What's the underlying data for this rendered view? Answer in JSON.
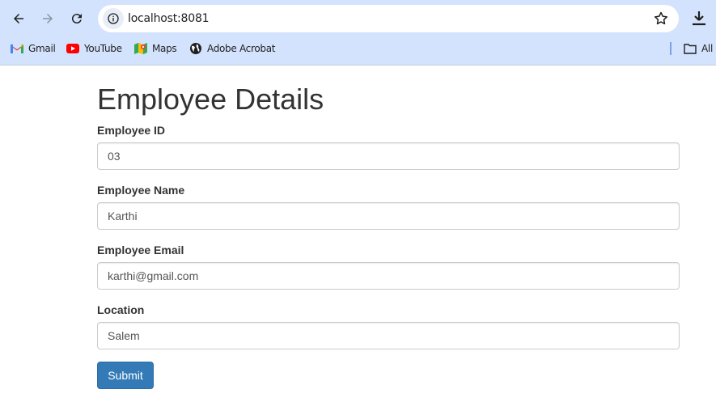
{
  "browser": {
    "url": "localhost:8081",
    "bookmarks": [
      {
        "label": "Gmail",
        "icon": "gmail-icon"
      },
      {
        "label": "YouTube",
        "icon": "youtube-icon"
      },
      {
        "label": "Maps",
        "icon": "maps-icon"
      },
      {
        "label": "Adobe Acrobat",
        "icon": "globe-icon"
      }
    ],
    "all_bookmarks_label": "All",
    "colors": {
      "chrome_bg": "#d3e3fd",
      "accent": "#337ab7"
    }
  },
  "page": {
    "title": "Employee Details",
    "fields": [
      {
        "label": "Employee ID",
        "value": "03"
      },
      {
        "label": "Employee Name",
        "value": "Karthi"
      },
      {
        "label": "Employee Email",
        "value": "karthi@gmail.com"
      },
      {
        "label": "Location",
        "value": "Salem"
      }
    ],
    "submit_label": "Submit"
  }
}
